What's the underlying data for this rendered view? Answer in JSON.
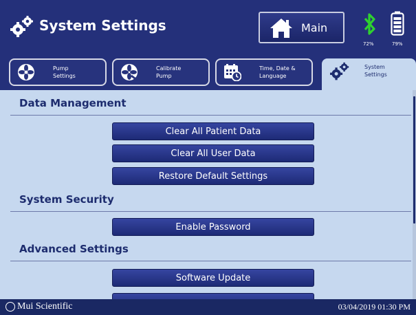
{
  "header": {
    "title": "System Settings",
    "main_button_label": "Main",
    "bluetooth_percent": "72%",
    "battery_percent": "79%",
    "bluetooth_color": "#2fd22f"
  },
  "tabs": [
    {
      "label_line1": "Pump",
      "label_line2": "Settings",
      "icon": "pump-fan-icon",
      "active": false
    },
    {
      "label_line1": "Calibrate",
      "label_line2": "Pump",
      "icon": "calibrate-fan-icon",
      "active": false
    },
    {
      "label_line1": "Time, Date &",
      "label_line2": "Language",
      "icon": "calendar-clock-icon",
      "active": false
    },
    {
      "label_line1": "System",
      "label_line2": "Settings",
      "icon": "gears-icon",
      "active": true
    }
  ],
  "sections": {
    "data_management": {
      "title": "Data Management",
      "buttons": [
        "Clear All Patient Data",
        "Clear All User Data",
        "Restore Default Settings"
      ]
    },
    "system_security": {
      "title": "System Security",
      "buttons": [
        "Enable Password"
      ]
    },
    "advanced_settings": {
      "title": "Advanced Settings",
      "buttons": [
        "Software Update"
      ]
    }
  },
  "footer": {
    "brand": "Mui Scientific",
    "datetime": "03/04/2019 01:30 PM"
  },
  "colors": {
    "header_bg": "#24307a",
    "content_bg": "#c6d8ef",
    "button_bg": "#2a3891"
  }
}
